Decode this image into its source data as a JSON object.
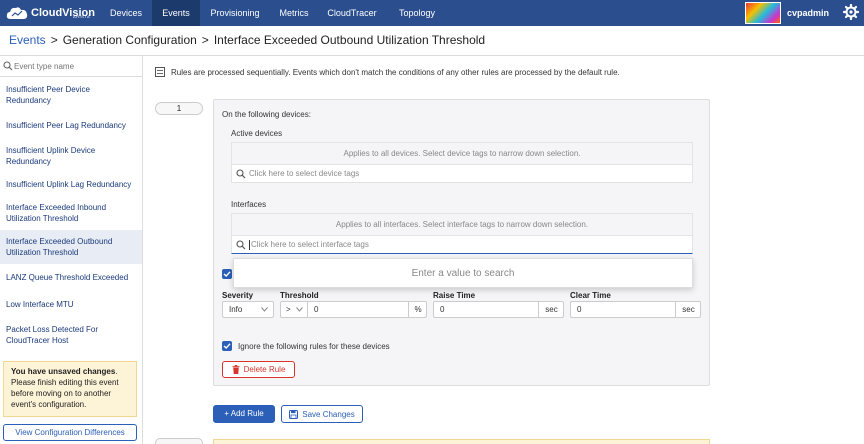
{
  "app": {
    "logo_text": "CloudVision",
    "logo_sub": "ARISTA"
  },
  "nav": {
    "tabs": [
      {
        "label": "Devices"
      },
      {
        "label": "Events"
      },
      {
        "label": "Provisioning"
      },
      {
        "label": "Metrics"
      },
      {
        "label": "CloudTracer"
      },
      {
        "label": "Topology"
      }
    ],
    "active_tab": "Events",
    "username": "cvpadmin"
  },
  "breadcrumb": {
    "root": "Events",
    "section": "Generation Configuration",
    "page": "Interface Exceeded Outbound Utilization Threshold",
    "separator": ">"
  },
  "sidebar": {
    "search_placeholder": "Event type name",
    "items": [
      {
        "label": "Insufficient Peer Device Redundancy"
      },
      {
        "label": "Insufficient Peer Lag Redundancy"
      },
      {
        "label": "Insufficient Uplink Device Redundancy"
      },
      {
        "label": "Insufficient Uplink Lag Redundancy"
      },
      {
        "label": "Interface Exceeded Inbound Utilization Threshold"
      },
      {
        "label": "Interface Exceeded Outbound Utilization Threshold"
      },
      {
        "label": "LANZ Queue Threshold Exceeded"
      },
      {
        "label": "Low Interface MTU"
      },
      {
        "label": "Packet Loss Detected For CloudTracer Host"
      }
    ],
    "active_index": 5,
    "unsaved_title": "You have unsaved changes",
    "unsaved_body": "Please finish editing this event before moving on to another event's configuration.",
    "view_diff_label": "View Configuration Differences"
  },
  "main": {
    "info_text": "Rules are processed sequentially. Events which don't match the conditions of any other rules are processed by the default rule.",
    "rule_number": "1",
    "on_devices_label": "On the following devices:",
    "active_devices_label": "Active devices",
    "devices_hint": "Applies to all devices. Select device tags to narrow down selection.",
    "devices_placeholder": "Click here to select device tags",
    "interfaces_label": "Interfaces",
    "interfaces_hint": "Applies to all interfaces. Select interface tags to narrow down selection.",
    "interfaces_placeholder": "Click here to select interface tags",
    "dropdown_hint": "Enter a value to search",
    "severity_label": "Severity",
    "severity_value": "Info",
    "threshold_label": "Threshold",
    "threshold_op": ">",
    "threshold_value": "0",
    "threshold_unit": "%",
    "raise_time_label": "Raise Time",
    "raise_time_value": "0",
    "raise_time_unit": "sec",
    "clear_time_label": "Clear Time",
    "clear_time_value": "0",
    "clear_time_unit": "sec",
    "ignore_label": "Ignore the following rules for these devices",
    "delete_label": "Delete Rule",
    "add_rule_label": "+ Add Rule",
    "save_label": "Save Changes"
  },
  "colors": {
    "nav_bg": "#2b4f8e",
    "accent": "#2b5fb8",
    "danger": "#d9342b",
    "warning_bg": "#fdf3d7"
  }
}
